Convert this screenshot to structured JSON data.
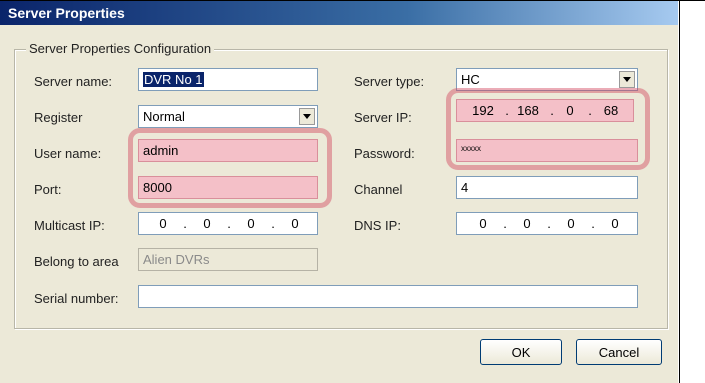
{
  "dialog": {
    "title": "Server Properties"
  },
  "group": {
    "title": "Server Properties Configuration"
  },
  "fields": {
    "server_name": {
      "label": "Server name:",
      "value": "DVR No 1"
    },
    "server_type": {
      "label": "Server type:",
      "value": "HC"
    },
    "register": {
      "label": "Register",
      "value": "Normal"
    },
    "server_ip": {
      "label": "Server IP:",
      "octets": [
        "192",
        "168",
        "0",
        "68"
      ]
    },
    "user_name": {
      "label": "User name:",
      "value": "admin"
    },
    "password": {
      "label": "Password:",
      "value": "xxxxx"
    },
    "port": {
      "label": "Port:",
      "value": "8000"
    },
    "channel": {
      "label": "Channel",
      "value": "4"
    },
    "multicast_ip": {
      "label": "Multicast IP:",
      "octets": [
        "0",
        "0",
        "0",
        "0"
      ]
    },
    "dns_ip": {
      "label": "DNS IP:",
      "octets": [
        "0",
        "0",
        "0",
        "0"
      ]
    },
    "belong_to_area": {
      "label": "Belong to area",
      "value": "Alien DVRs"
    },
    "serial_number": {
      "label": "Serial number:",
      "value": ""
    }
  },
  "buttons": {
    "ok": "OK",
    "cancel": "Cancel"
  },
  "colors": {
    "highlight": "#d2465f",
    "title_bar": "#0a246a",
    "dialog_bg": "#ece9d8"
  }
}
